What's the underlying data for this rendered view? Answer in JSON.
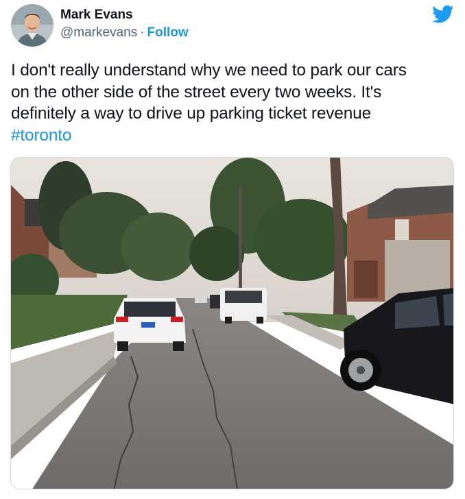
{
  "author": {
    "name": "Mark Evans",
    "handle": "@markevans",
    "separator": "·",
    "follow_label": "Follow",
    "avatar_icon": "user-avatar"
  },
  "tweet": {
    "lines": [
      "I don't really understand why we need to park our cars",
      "on the other side of the street every two weeks. It's",
      "definitely a way to drive up parking ticket revenue"
    ],
    "hashtag": "#toronto"
  },
  "brand": {
    "icon": "twitter-bird-icon",
    "accent_color": "#1b95e0"
  },
  "media": {
    "type": "photo",
    "icon": "street-photo"
  }
}
